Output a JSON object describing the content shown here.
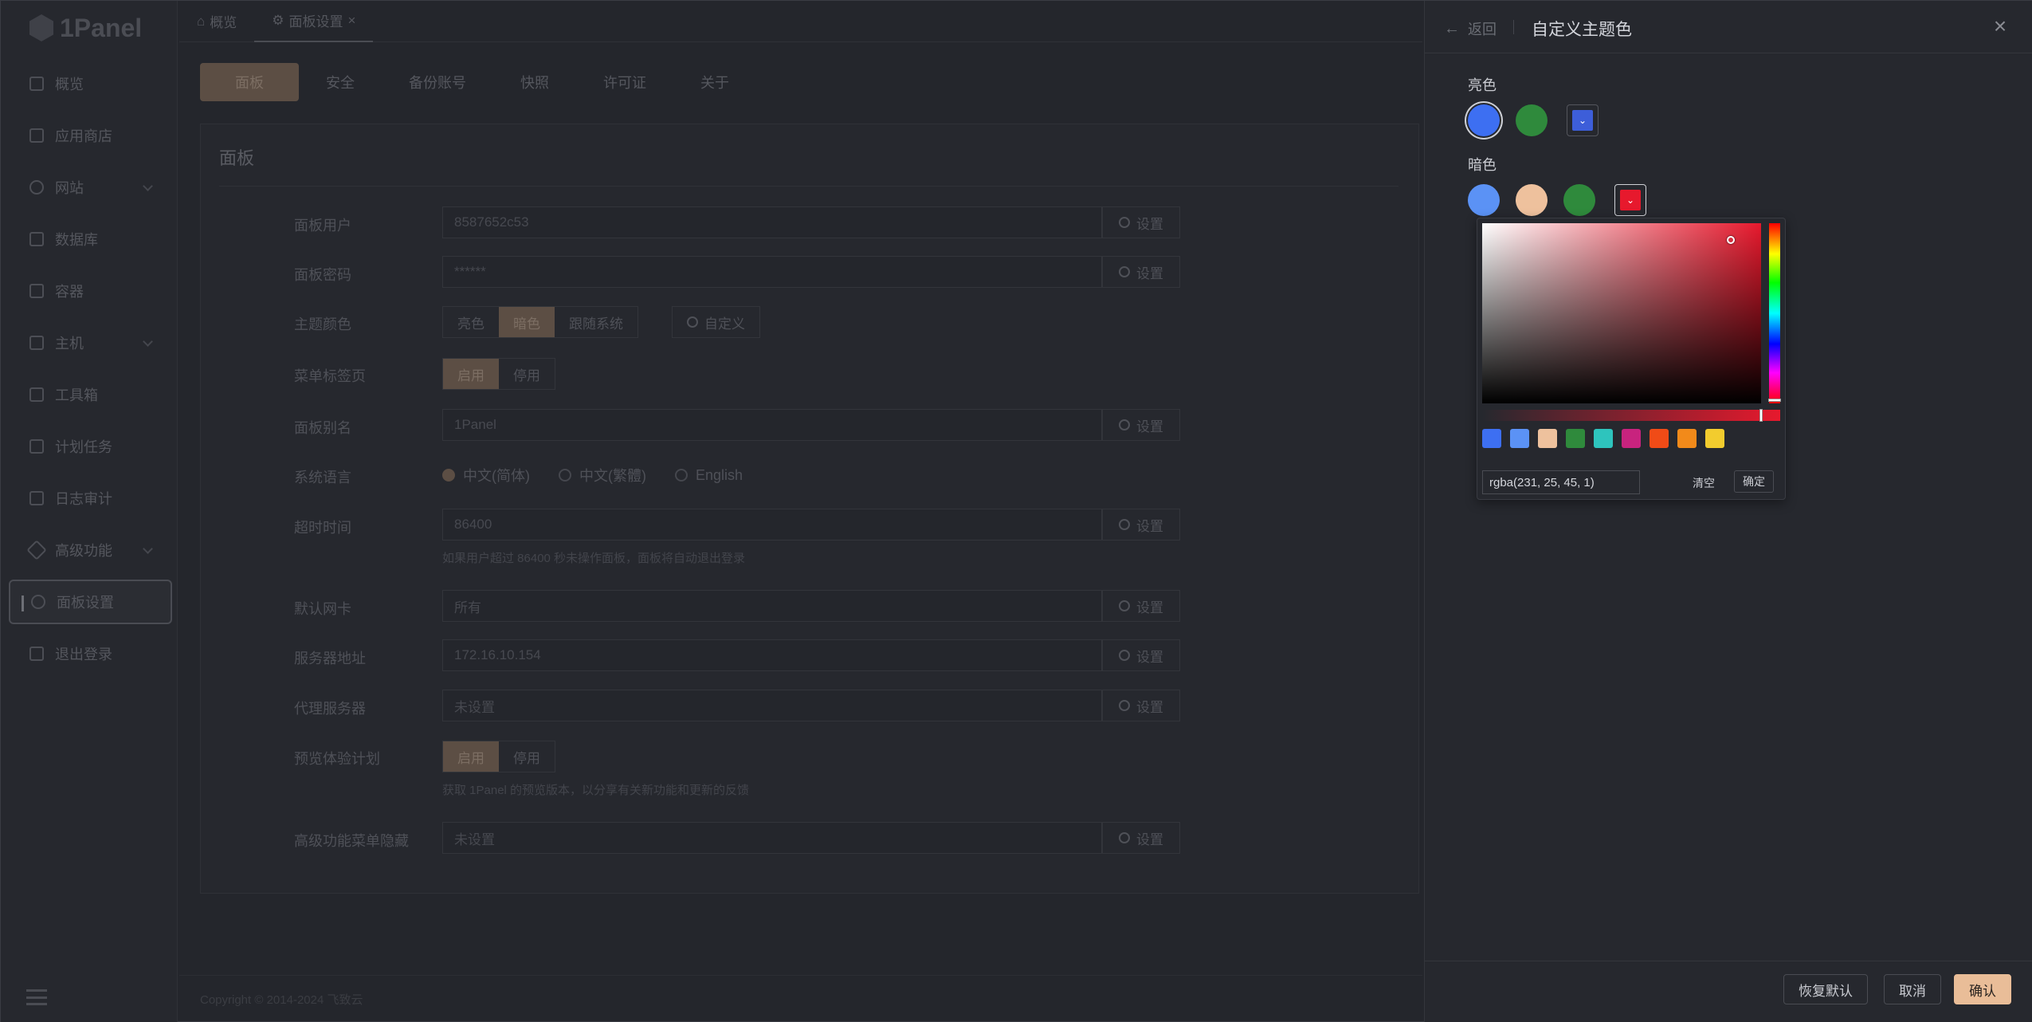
{
  "app": {
    "logo_text": "1Panel"
  },
  "sidebar": {
    "items": [
      {
        "label": "概览"
      },
      {
        "label": "应用商店"
      },
      {
        "label": "网站"
      },
      {
        "label": "数据库"
      },
      {
        "label": "容器"
      },
      {
        "label": "主机"
      },
      {
        "label": "工具箱"
      },
      {
        "label": "计划任务"
      },
      {
        "label": "日志审计"
      },
      {
        "label": "高级功能"
      },
      {
        "label": "面板设置"
      },
      {
        "label": "退出登录"
      }
    ]
  },
  "tabs": [
    {
      "label": "概览"
    },
    {
      "label": "面板设置",
      "close": "×"
    }
  ],
  "subtabs": [
    "面板",
    "安全",
    "备份账号",
    "快照",
    "许可证",
    "关于"
  ],
  "panel": {
    "title": "面板",
    "set_label": "设置",
    "rows": {
      "user": {
        "label": "面板用户",
        "value": "8587652c53"
      },
      "password": {
        "label": "面板密码",
        "value": "******"
      },
      "theme": {
        "label": "主题颜色",
        "options": [
          "亮色",
          "暗色",
          "跟随系统"
        ],
        "custom": "自定义"
      },
      "menu_tabs": {
        "label": "菜单标签页",
        "on": "启用",
        "off": "停用"
      },
      "alias": {
        "label": "面板别名",
        "value": "1Panel"
      },
      "language": {
        "label": "系统语言",
        "options": [
          "中文(简体)",
          "中文(繁體)",
          "English"
        ]
      },
      "timeout": {
        "label": "超时时间",
        "value": "86400",
        "hint": "如果用户超过 86400 秒未操作面板，面板将自动退出登录"
      },
      "nic": {
        "label": "默认网卡",
        "value": "所有"
      },
      "server": {
        "label": "服务器地址",
        "value": "172.16.10.154"
      },
      "proxy": {
        "label": "代理服务器",
        "value": "未设置"
      },
      "preview": {
        "label": "预览体验计划",
        "on": "启用",
        "off": "停用",
        "hint": "获取 1Panel 的预览版本，以分享有关新功能和更新的反馈"
      },
      "hide_menu": {
        "label": "高级功能菜单隐藏",
        "value": "未设置"
      }
    },
    "copyright": "Copyright © 2014-2024  飞致云"
  },
  "drawer": {
    "back": "返回",
    "title": "自定义主题色",
    "light_label": "亮色",
    "dark_label": "暗色",
    "light_swatches": [
      "#3d6ff2",
      "#2f8a3c"
    ],
    "light_custom": "#3d5ed9",
    "dark_swatches": [
      "#5b92f5",
      "#eec19d",
      "#2f8a3c"
    ],
    "dark_custom": "#e7192d",
    "picker": {
      "value": "rgba(231, 25, 45, 1)",
      "clear": "清空",
      "ok": "确定",
      "presets": [
        "#3d6ff2",
        "#5b92f5",
        "#eec19d",
        "#2f8a3c",
        "#2ec4bd",
        "#c8237e",
        "#f04b17",
        "#f28a1a",
        "#f2cc2e"
      ]
    },
    "footer": {
      "reset": "恢复默认",
      "cancel": "取消",
      "confirm": "确认"
    }
  }
}
